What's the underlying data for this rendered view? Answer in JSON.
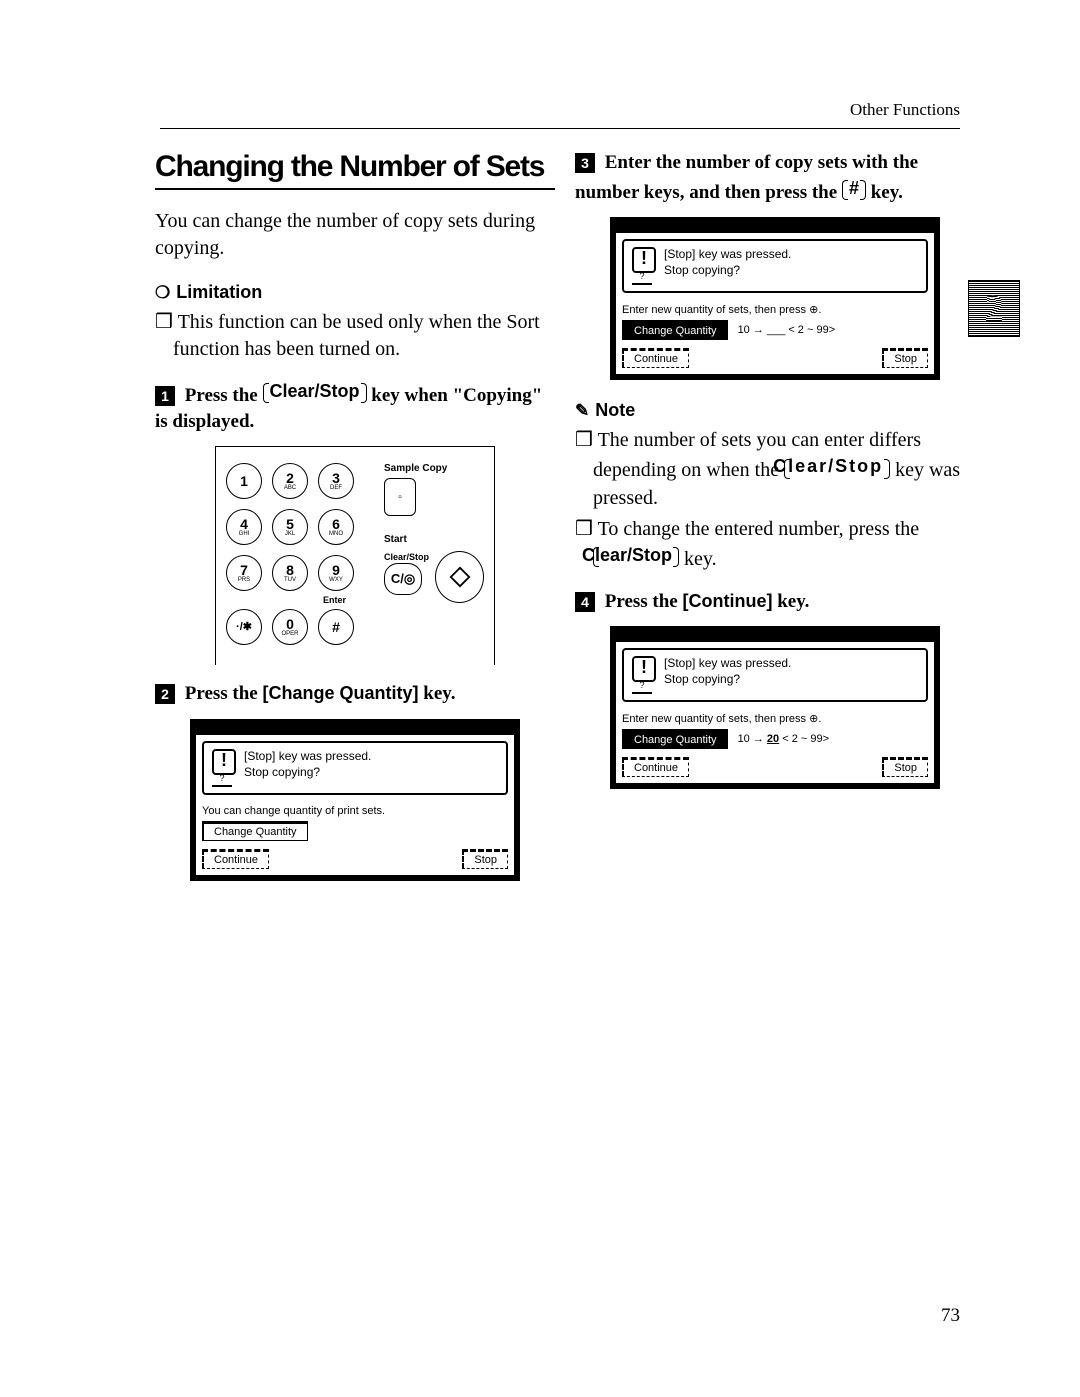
{
  "meta": {
    "header_right": "Other Functions",
    "page_number": "73",
    "chapter_tab": "2"
  },
  "left": {
    "title": "Changing the Number of Sets",
    "intro": "You can change the number of copy sets during copying.",
    "limitation_icon": "lightbulb-icon",
    "limitation_heading": "Limitation",
    "limitation_bullet": "This function can be used only when the Sort function has been turned on.",
    "step1_pre": "Press the ",
    "step1_key": "Clear/Stop",
    "step1_post": " key when \"Copying\" is displayed.",
    "step2_pre": "Press the ",
    "step2_key": "[Change Quantity]",
    "step2_post": " key.",
    "keypad": {
      "keys": [
        {
          "d": "1",
          "s": ""
        },
        {
          "d": "2",
          "s": "ABC"
        },
        {
          "d": "3",
          "s": "DEF"
        },
        {
          "d": "4",
          "s": "GHI"
        },
        {
          "d": "5",
          "s": "JKL"
        },
        {
          "d": "6",
          "s": "MNO"
        },
        {
          "d": "7",
          "s": "PRS"
        },
        {
          "d": "8",
          "s": "TUV"
        },
        {
          "d": "9",
          "s": "WXY"
        },
        {
          "d": "·/✱",
          "s": ""
        },
        {
          "d": "0",
          "s": "OPER"
        },
        {
          "d": "#",
          "s": ""
        }
      ],
      "label_sample": "Sample Copy",
      "label_start": "Start",
      "label_clearstop": "Clear/Stop",
      "label_enter": "Enter",
      "clear_key": "C/◎"
    },
    "screen2": {
      "msg1": "[Stop] key was pressed.",
      "msg2": "Stop copying?",
      "instr": "You can change quantity of print sets.",
      "change_q": "Change Quantity",
      "continue": "Continue",
      "stop": "Stop"
    }
  },
  "right": {
    "step3_text": "Enter the number of copy sets with the number keys, and then press the ",
    "step3_key": "#",
    "step3_post": " key.",
    "screen3": {
      "msg1": "[Stop] key was pressed.",
      "msg2": "Stop copying?",
      "instr": "Enter new quantity of sets, then press ⊕.",
      "change_q": "Change Quantity",
      "numline": "10 → ___   <  2 ~ 99>",
      "continue": "Continue",
      "stop": "Stop"
    },
    "note_heading": "Note",
    "note_bullet1_pre": "The number of sets you can enter differs depending on when the ",
    "note_bullet1_key": "Clear/Stop",
    "note_bullet1_post": " key was pressed.",
    "note_bullet2_pre": "To change the entered number, press the ",
    "note_bullet2_key": "Clear/Stop",
    "note_bullet2_post": " key.",
    "step4_pre": "Press the ",
    "step4_key": "[Continue]",
    "step4_post": " key.",
    "screen4": {
      "msg1": "[Stop] key was pressed.",
      "msg2": "Stop copying?",
      "instr": "Enter new quantity of sets, then press ⊕.",
      "change_q": "Change Quantity",
      "num_before": "10 → ",
      "num_curr": "20",
      "num_after": "   <  2 ~ 99>",
      "continue": "Continue",
      "stop": "Stop"
    }
  }
}
